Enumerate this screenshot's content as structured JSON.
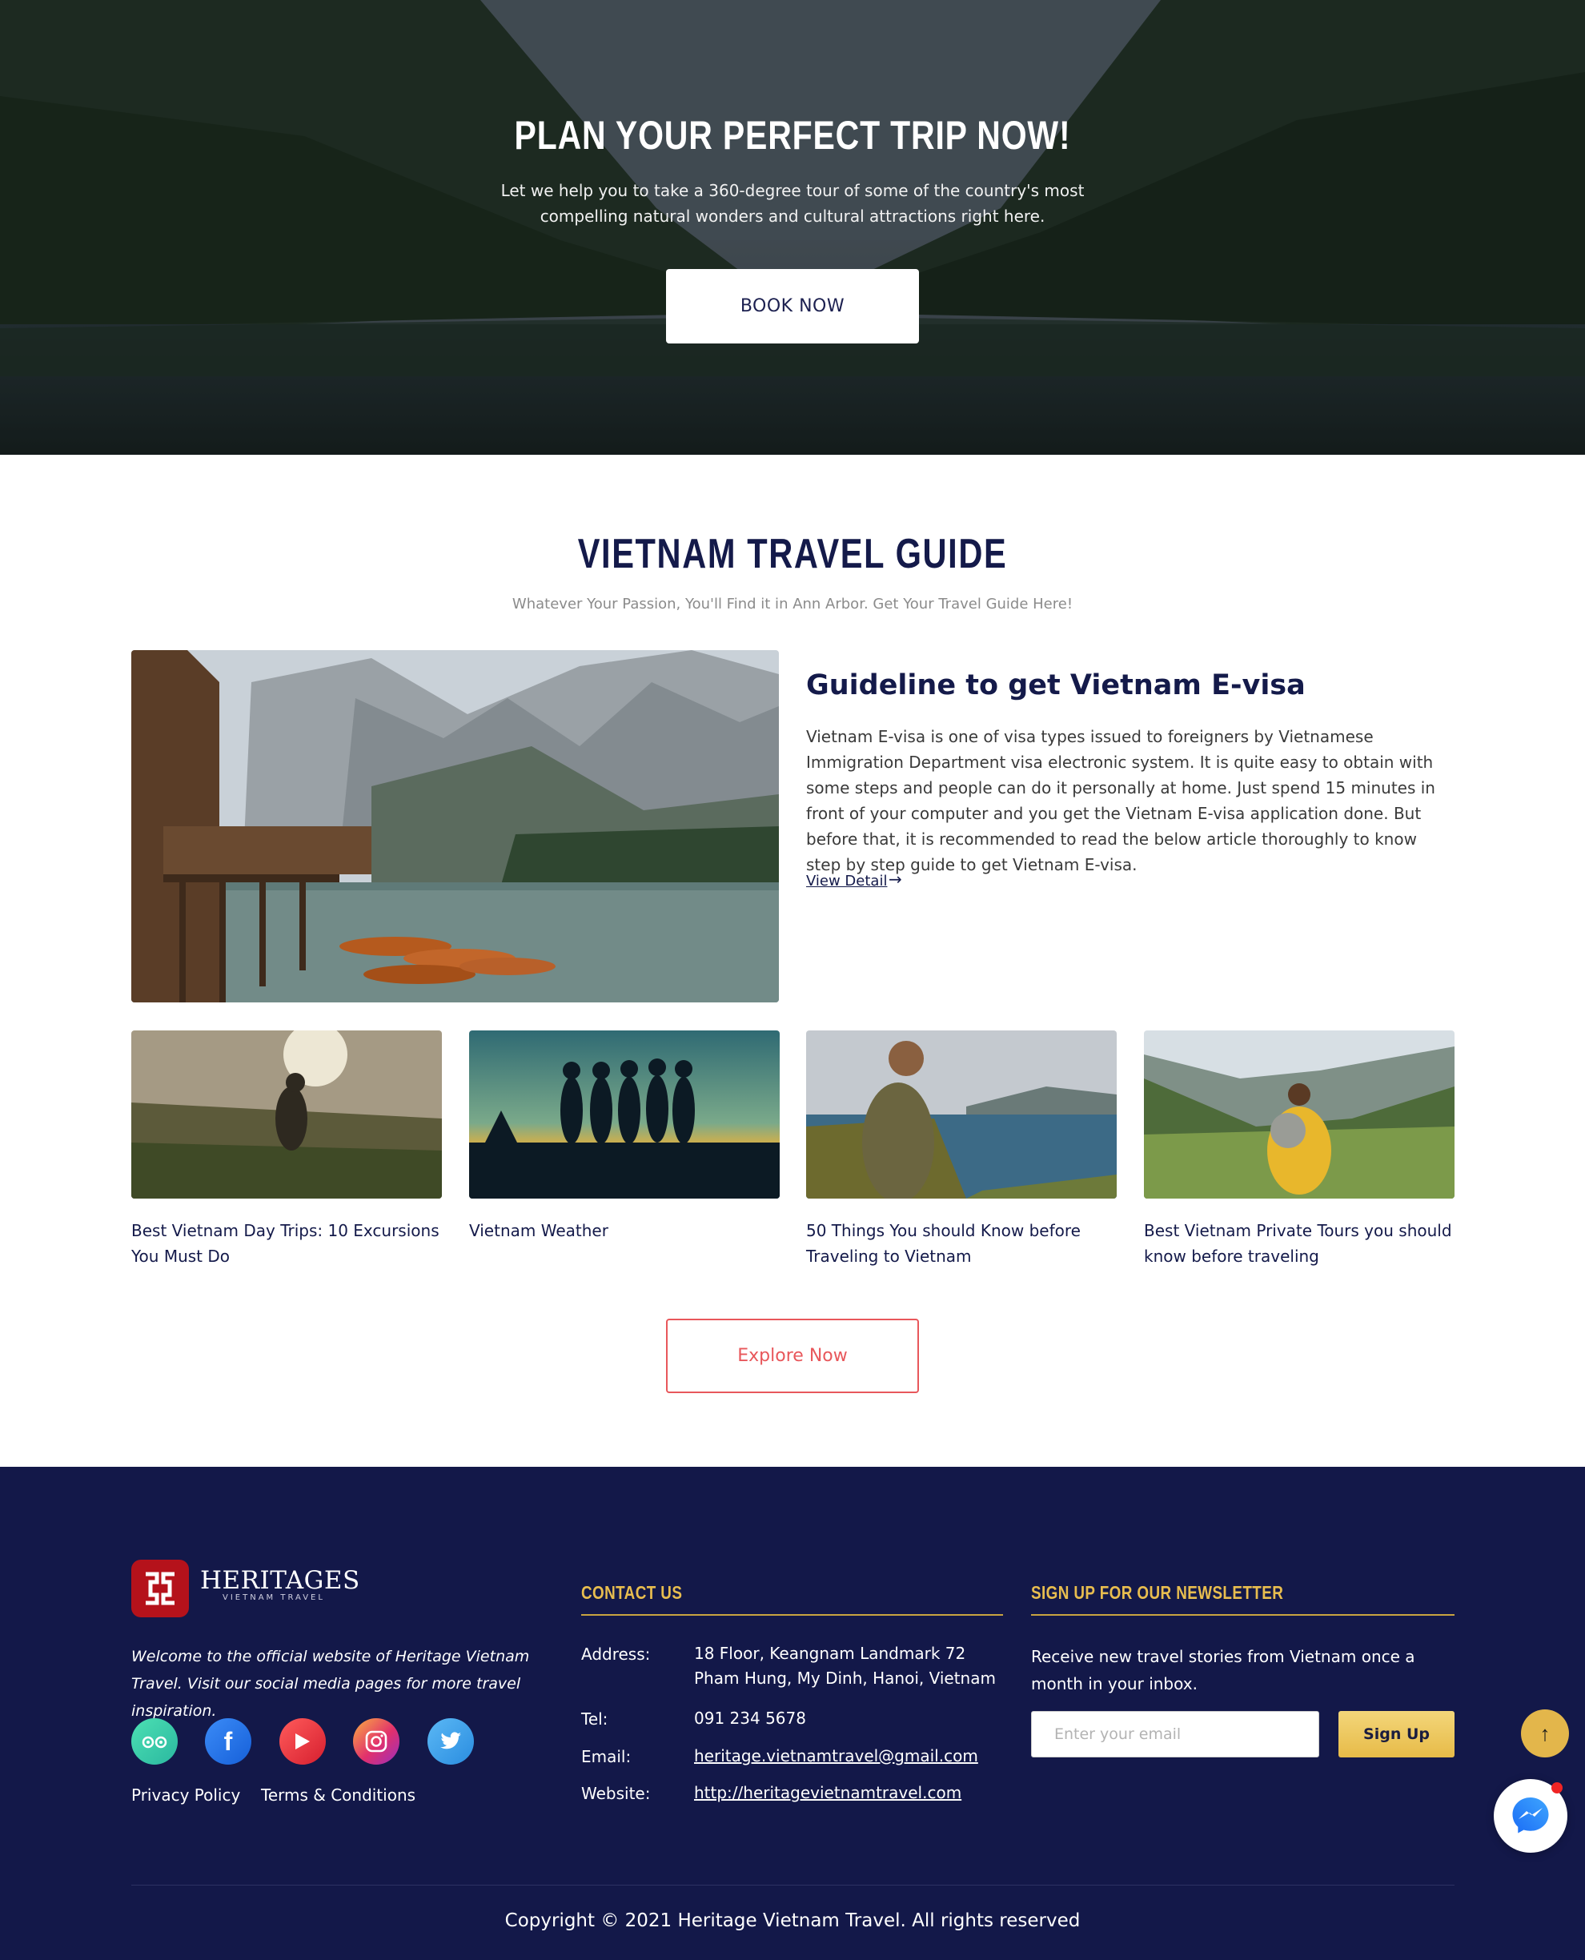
{
  "hero": {
    "title": "PLAN YOUR PERFECT TRIP NOW!",
    "subtitle": "Let we help you to take a 360-degree tour of some of the country's most compelling natural wonders and cultural attractions right here.",
    "button_label": "BOOK NOW"
  },
  "guide": {
    "title": "VIETNAM TRAVEL GUIDE",
    "subtitle": "Whatever Your Passion, You'll Find it in Ann Arbor. Get Your Travel Guide Here!",
    "featured": {
      "title": "Guideline to get Vietnam E-visa",
      "text": "Vietnam E-visa is one of visa types issued to foreigners by Vietnamese Immigration Department visa electronic system. It is quite easy to obtain with some steps and people can do it personally at home. Just spend 15 minutes in front of your computer and you get the Vietnam E-visa application done. But before that, it is recommended to read the below article thoroughly to know step by step guide to get Vietnam E-visa.",
      "link_label": "View Detail",
      "link_arrow": "→"
    },
    "cards": [
      {
        "title": "Best Vietnam Day Trips: 10 Excursions You Must Do"
      },
      {
        "title": "Vietnam Weather"
      },
      {
        "title": "50 Things You should Know before Traveling to Vietnam"
      },
      {
        "title": "Best Vietnam Private Tours you should know before traveling"
      }
    ],
    "explore_label": "Explore Now"
  },
  "footer": {
    "brand": {
      "name": "HERITAGES",
      "tagline": "VIETNAM TRAVEL"
    },
    "intro": "Welcome to the official website of Heritage Vietnam Travel. Visit our social media pages for more travel inspiration.",
    "social": [
      {
        "icon": "tripadvisor-icon",
        "color": "#34d8a8"
      },
      {
        "icon": "facebook-icon",
        "color": "#1877f2"
      },
      {
        "icon": "youtube-icon",
        "color": "#ef3b3b"
      },
      {
        "icon": "instagram-icon",
        "color": "#e1306c"
      },
      {
        "icon": "twitter-icon",
        "color": "#3aa0ee"
      }
    ],
    "links": {
      "privacy": "Privacy Policy",
      "terms": "Terms & Conditions"
    },
    "contact": {
      "heading": "CONTACT US",
      "address_label": "Address:",
      "address_line1": "18 Floor, Keangnam Landmark 72",
      "address_line2": "Pham Hung, My Dinh, Hanoi, Vietnam",
      "tel_label": "Tel:",
      "tel": "091 234 5678",
      "email_label": "Email:",
      "email": "heritage.vietnamtravel@gmail.com",
      "website_label": "Website:",
      "website": "http://heritagevietnamtravel.com"
    },
    "newsletter": {
      "heading": "SIGN UP FOR OUR NEWSLETTER",
      "text": "Receive new travel stories from Vietnam once a month in your inbox.",
      "placeholder": "Enter your email",
      "button_label": "Sign Up"
    },
    "copyright": "Copyright © 2021 Heritage Vietnam Travel. All rights reserved"
  },
  "floating": {
    "to_top_icon": "↑"
  },
  "colors": {
    "navy": "#131849",
    "accent_gold": "#e8bd4f",
    "accent_red": "#e8575b",
    "brand_red": "#b5121b"
  }
}
